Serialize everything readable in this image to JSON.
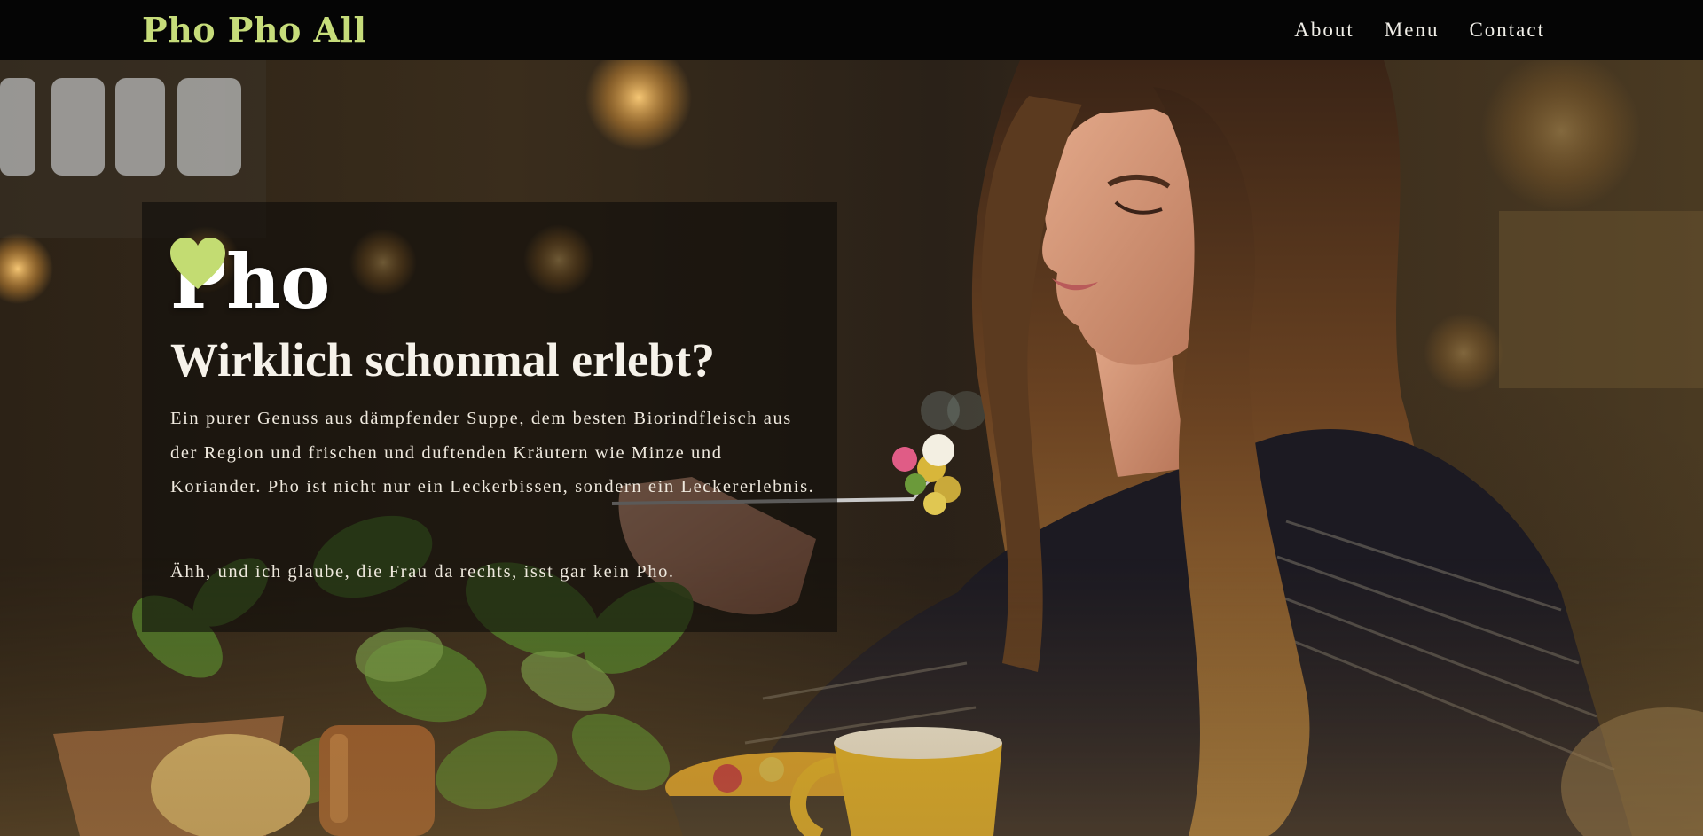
{
  "header": {
    "brand": "Pho Pho All",
    "nav": [
      {
        "label": "About"
      },
      {
        "label": "Menu"
      },
      {
        "label": "Contact"
      }
    ]
  },
  "hero": {
    "title": "Pho",
    "heart_icon": "heart-icon",
    "subtitle": "Wirklich schonmal erlebt?",
    "text": "Ein purer Genuss aus dämpfender Suppe, dem besten Biorindfleisch aus der Region und frischen und duftenden Kräutern wie Minze und Koriander. Pho ist nicht nur ein Leckerbissen, sondern ein Leckererlebnis.",
    "note": "Ähh, und ich glaube, die Frau da rechts, isst gar kein Pho."
  },
  "colors": {
    "brand": "#c6dc7a",
    "heart": "#c3dc72",
    "topbar": "#050505",
    "card": "rgba(12,10,8,0.58)",
    "text": "#efe9de"
  }
}
